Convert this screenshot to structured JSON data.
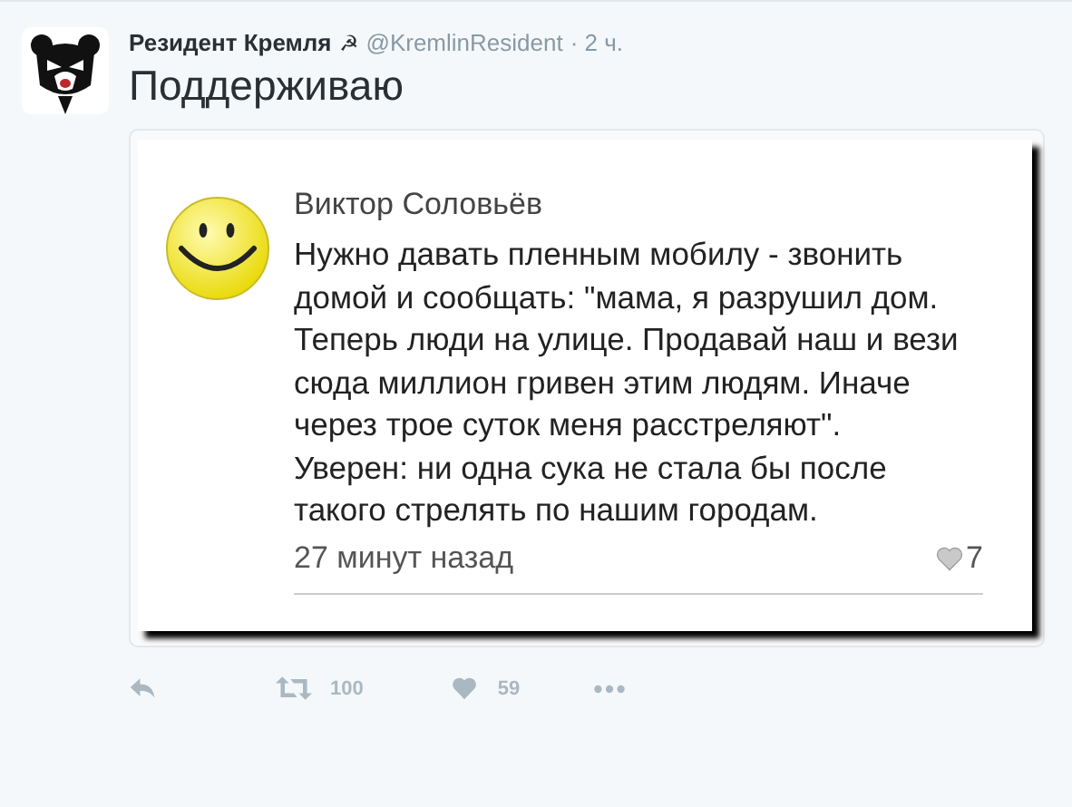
{
  "tweet": {
    "author": "Резидент Кремля",
    "author_mark": "☭",
    "handle": "@KremlinResident",
    "time": "· 2 ч.",
    "text": "Поддерживаю"
  },
  "embedded_post": {
    "author": "Виктор Соловьёв",
    "text": "Нужно давать пленным мобилу - звонить домой и сообщать: \"мама, я разрушил дом. Теперь люди на улице. Продавай наш и вези сюда миллион гривен этим людям. Иначе через трое суток меня расстреляют\".\nУверен: ни одна сука не стала бы после такого стрелять по нашим городам.",
    "time": "27 минут назад",
    "likes": "7"
  },
  "actions": [
    {
      "kind": "reply"
    },
    {
      "kind": "retweet",
      "count": "100"
    },
    {
      "kind": "like",
      "count": "59"
    },
    {
      "kind": "more"
    }
  ]
}
